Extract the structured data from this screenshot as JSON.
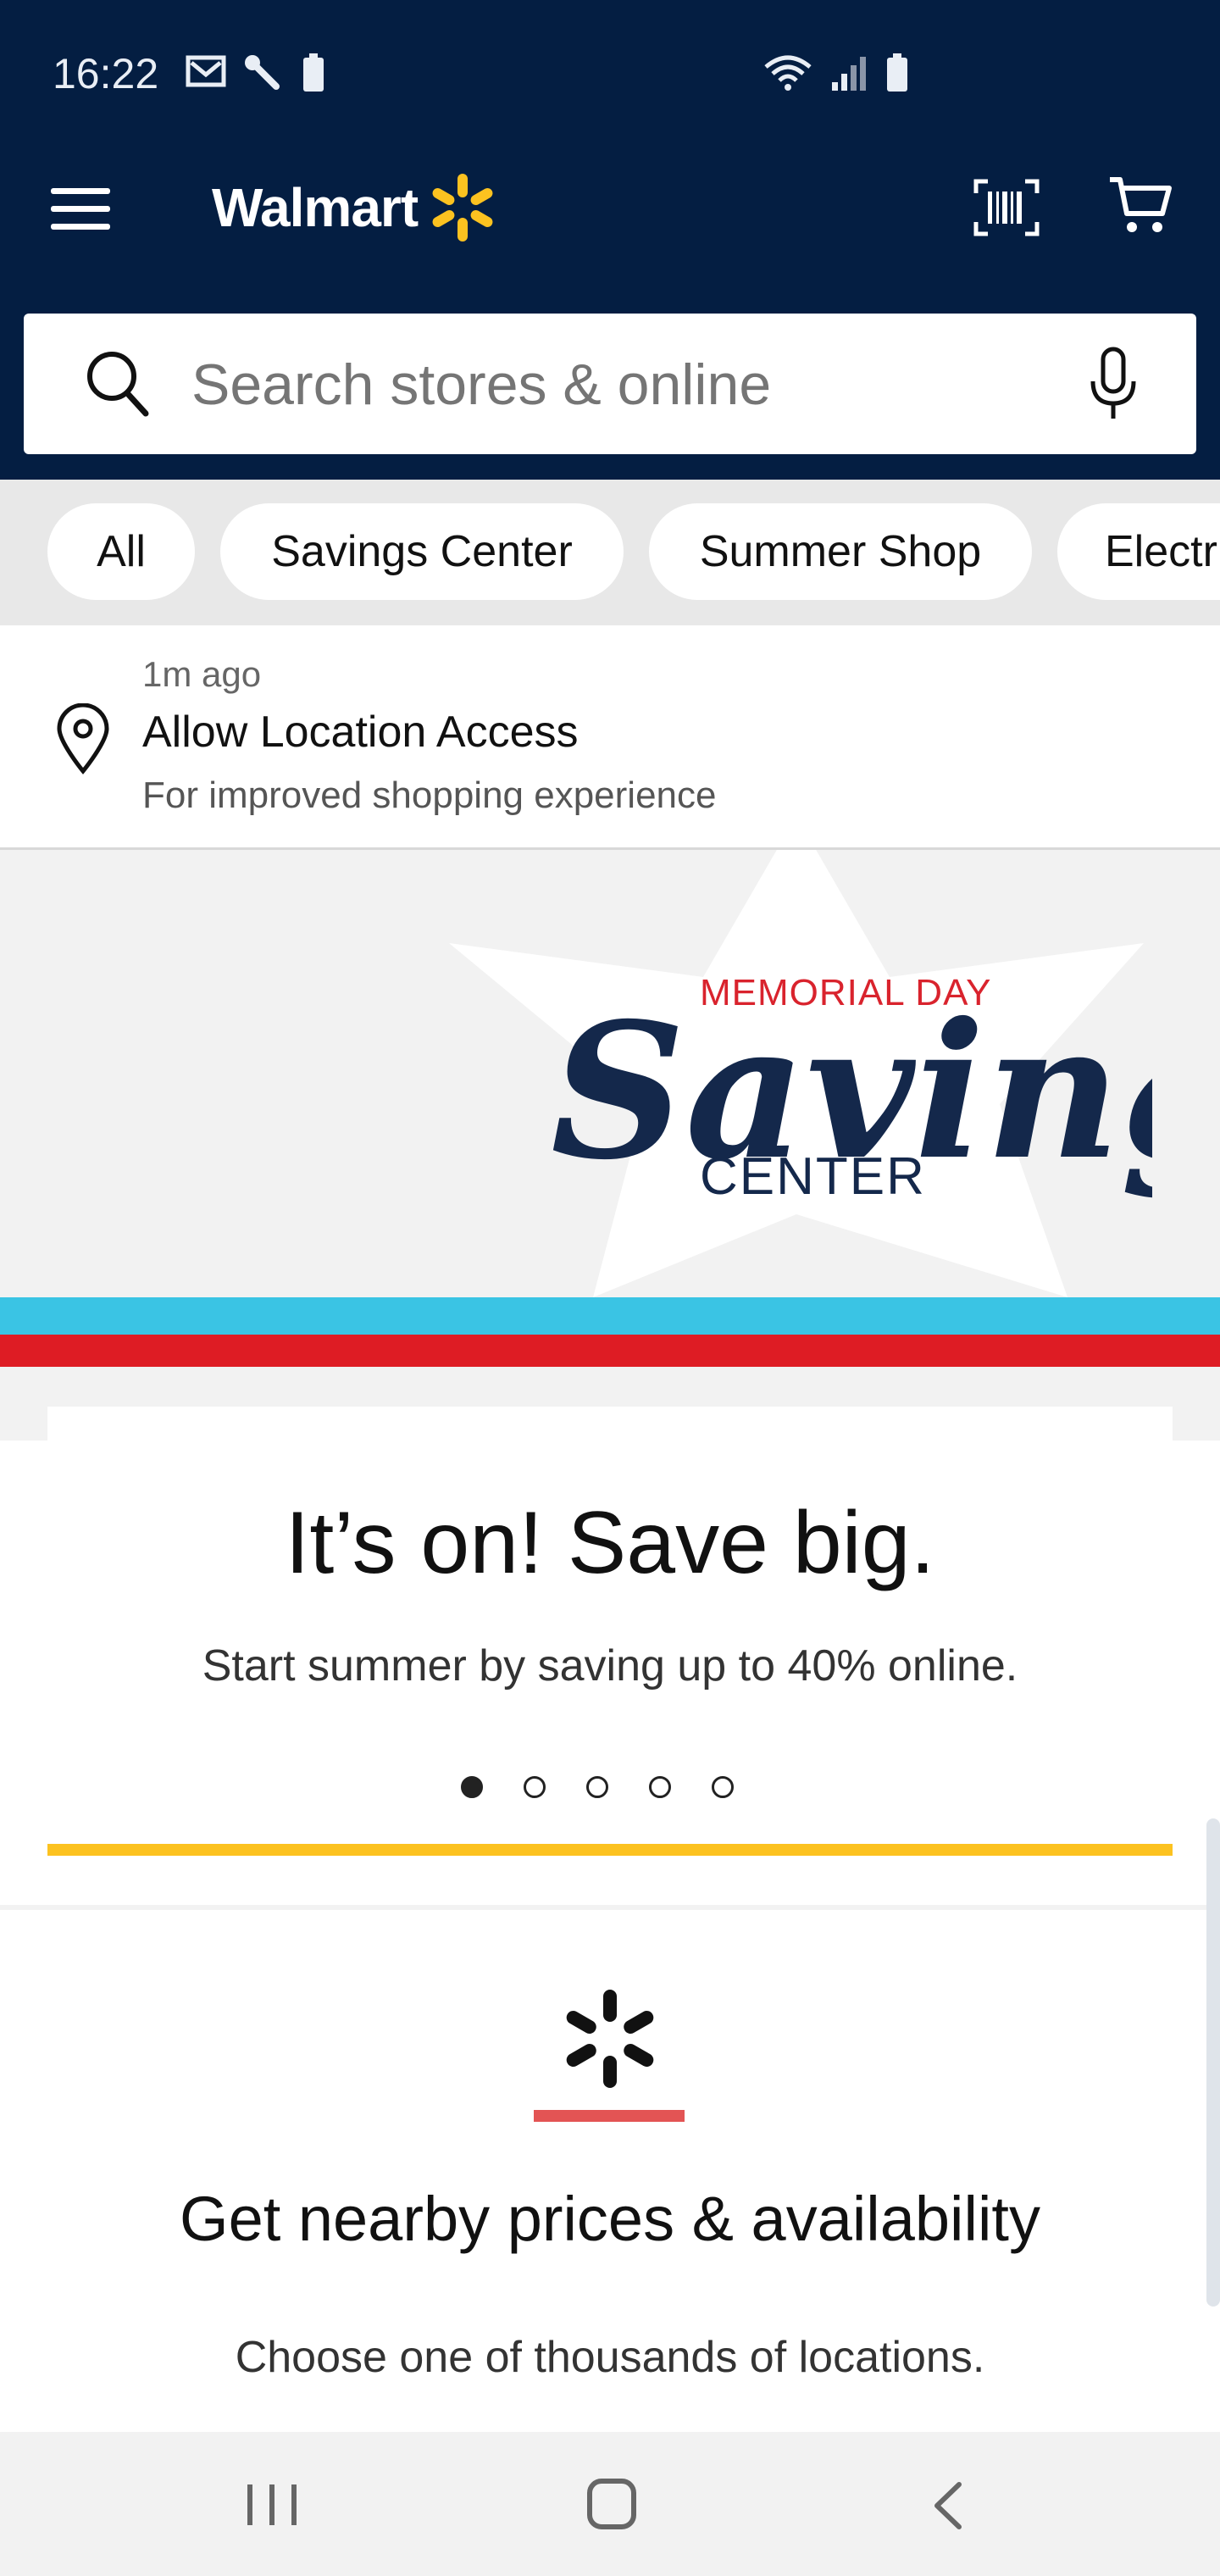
{
  "status_bar": {
    "time": "16:22",
    "left_icons": [
      "mail-icon",
      "wrench-icon",
      "battery-saver-icon"
    ],
    "right_icons": [
      "wifi-icon",
      "signal-icon",
      "battery-icon"
    ]
  },
  "app_bar": {
    "brand": "Walmart",
    "brand_color": "#041e42",
    "spark_color": "#fcc220"
  },
  "search": {
    "placeholder": "Search stores & online",
    "value": ""
  },
  "chips": [
    {
      "label": "All"
    },
    {
      "label": "Savings Center"
    },
    {
      "label": "Summer Shop"
    },
    {
      "label": "Electr"
    }
  ],
  "notification": {
    "time": "1m ago",
    "title": "Allow Location Access",
    "subtitle": "For improved shopping experience"
  },
  "banner": {
    "line1": "MEMORIAL DAY",
    "script": "Savings",
    "line3": "CENTER",
    "stripe_blue": "#3ac4e4",
    "stripe_red": "#de1c24"
  },
  "promo": {
    "title": "It’s on! Save big.",
    "subtitle": "Start summer by saving up to 40% online.",
    "carousel_total": 5,
    "carousel_active": 1,
    "accent_bar": "#fcc220"
  },
  "location_card": {
    "title": "Get nearby prices & availability",
    "subtitle": "Choose one of thousands of locations.",
    "underline_color": "#e35454"
  },
  "nav_bar": {
    "buttons": [
      "recent-apps-icon",
      "home-icon",
      "back-icon"
    ]
  }
}
